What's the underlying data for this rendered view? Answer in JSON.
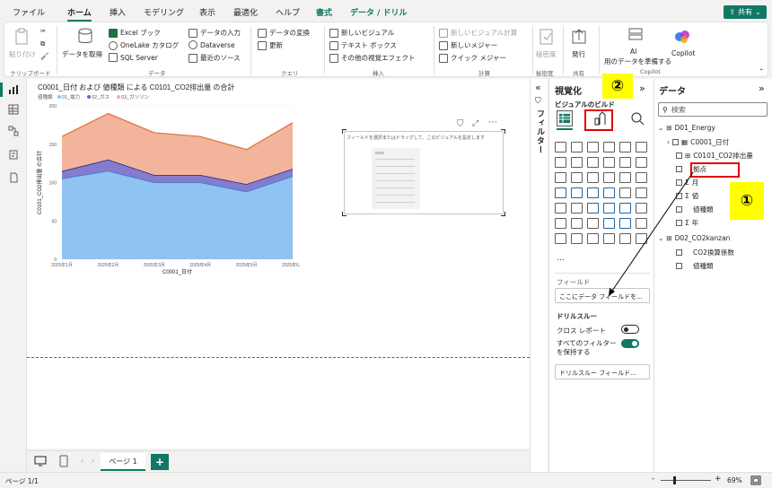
{
  "ribbon_tabs": [
    "ファイル",
    "ホーム",
    "挿入",
    "モデリング",
    "表示",
    "最適化",
    "ヘルプ",
    "書式",
    "データ / ドリル"
  ],
  "share_label": "共有",
  "ribbon": {
    "clipboard": {
      "paste": "貼り付け",
      "group": "クリップボード"
    },
    "data": {
      "get_data": "データを取得",
      "excel": "Excel ブック",
      "onelake": "OneLake カタログ",
      "sql": "SQL Server",
      "enter_data": "データの入力",
      "dataverse": "Dataverse",
      "recent": "最近のソース",
      "group": "データ"
    },
    "queries": {
      "transform": "データの変換",
      "refresh": "更新",
      "group": "クエリ"
    },
    "insert": {
      "new_visual": "新しいビジュアル",
      "text_box": "テキスト ボックス",
      "more_visuals": "その他の視覚エフェクト",
      "group": "挿入"
    },
    "calc": {
      "new_visual_calc": "新しいビジュアル計算",
      "new_measure": "新しいメジャー",
      "quick_measure": "クイック メジャー",
      "group": "計算"
    },
    "sensitivity": {
      "label": "秘密度",
      "group": "秘密度"
    },
    "share": {
      "publish": "発行",
      "group": "共有"
    },
    "ai": {
      "label": "AI",
      "sub": "用のデータを準備する",
      "copilot": "Copilot",
      "group": "Copilot"
    }
  },
  "chart_data": {
    "type": "area",
    "title": "C0001_日付 および 値種類 による C0101_CO2排出量 の合計",
    "legend_title": "値種類",
    "xlabel": "C0001_日付",
    "ylabel": "C0101_CO2排出量 の合計",
    "categories": [
      "2025年1月",
      "2025年2月",
      "2025年3月",
      "2025年4月",
      "2025年5月",
      "2025年6月"
    ],
    "ylim": [
      0,
      200
    ],
    "yticks": [
      "0",
      "50",
      "100",
      "150",
      "200"
    ],
    "stacked": true,
    "series": [
      {
        "name": "01_電力",
        "color": "#8fc3f2",
        "values": [
          105,
          115,
          100,
          100,
          88,
          108
        ]
      },
      {
        "name": "02_ガス",
        "color": "#6f66c4",
        "values": [
          10,
          15,
          10,
          10,
          10,
          10
        ]
      },
      {
        "name": "03_ガソリン",
        "color": "#f2b49a",
        "values": [
          45,
          60,
          55,
          50,
          45,
          60
        ]
      }
    ]
  },
  "placeholder_visual": {
    "text": "フィールドを選択またはドラッグして、このビジュアルを設定します"
  },
  "filters_label": "フィルター",
  "viz_pane": {
    "title": "視覚化",
    "subtitle": "ビジュアルのビルド",
    "field_header": "フィールド",
    "field_placeholder": "ここにデータ フィールドを...",
    "drill_header": "ドリルスルー",
    "cross_report": "クロス レポート",
    "cross_state": "オフ",
    "keep_filters": "すべてのフィルターを保持する",
    "keep_state": "オン",
    "drill_placeholder": "ドリルスルー フィールド...",
    "more": "..."
  },
  "data_pane": {
    "title": "データ",
    "search_placeholder": "検索",
    "tables": [
      {
        "name": "D01_Energy",
        "fields": [
          "C0001_日付",
          "C0101_CO2排出量",
          "拠点",
          "月",
          "値",
          "値種類",
          "年"
        ]
      },
      {
        "name": "D02_CO2kanzan",
        "fields": [
          "CO2換算係数",
          "値種類"
        ]
      }
    ]
  },
  "callouts": {
    "one": "①",
    "two": "②"
  },
  "pages": {
    "tab": "ページ 1",
    "add": "+"
  },
  "status": {
    "page": "ページ 1/1",
    "zoom": "69%",
    "minus": "-",
    "plus": "+"
  }
}
